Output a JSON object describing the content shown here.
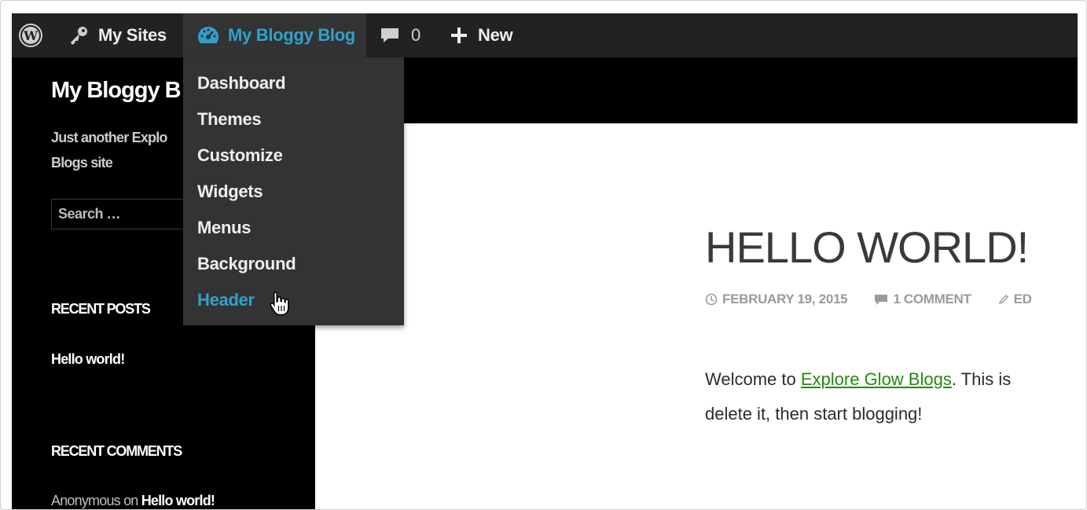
{
  "admin_bar": {
    "my_sites_label": "My Sites",
    "blog_label": "My Bloggy Blog",
    "comments_count": "0",
    "new_label": "New"
  },
  "blog_menu": {
    "items": [
      "Dashboard",
      "Themes",
      "Customize",
      "Widgets",
      "Menus",
      "Background",
      "Header"
    ],
    "active_item": "Header"
  },
  "sidebar": {
    "site_title": "My Bloggy B",
    "site_description": "Just another Explo Blogs site",
    "search_placeholder": "Search …",
    "recent_posts_title": "RECENT POSTS",
    "recent_posts": [
      "Hello world!"
    ],
    "recent_comments_title": "RECENT COMMENTS",
    "recent_comment_author": "Anonymous",
    "recent_comment_on": "on",
    "recent_comment_post": "Hello world!"
  },
  "post": {
    "title": "HELLO WORLD!",
    "date": "FEBRUARY 19, 2015",
    "comments": "1 COMMENT",
    "edit": "ED",
    "body_prefix": "Welcome to ",
    "body_link": "Explore Glow Blogs",
    "body_after_link": ". This is",
    "body_line2": "delete it, then start blogging!"
  },
  "colors": {
    "admin_bar_bg": "#222222",
    "menu_bg": "#333333",
    "highlight": "#2ea2cc",
    "link_green": "#24890d"
  },
  "icons": {
    "wordpress": "wordpress-logo-icon",
    "my_sites": "key-icon",
    "blog": "dashboard-gauge-icon",
    "comments": "comment-bubble-icon",
    "new": "plus-icon",
    "clock": "clock-icon",
    "edit": "pencil-icon",
    "cursor": "hand-pointer-icon"
  }
}
